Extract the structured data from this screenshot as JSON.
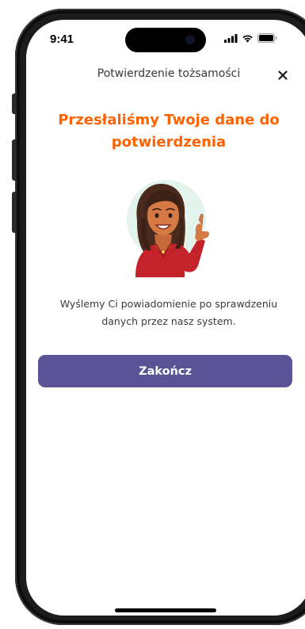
{
  "status_bar": {
    "time": "9:41"
  },
  "header": {
    "title": "Potwierdzenie tożsamości"
  },
  "content": {
    "headline": "Przesłaliśmy Twoje dane do potwierdzenia",
    "message": "Wyślemy Ci powiadomienie po sprawdzeniu danych przez nasz system."
  },
  "actions": {
    "finish_label": "Zakończ"
  },
  "icons": {
    "close": "close-icon",
    "illustration": "woman-thumbs-up-illustration",
    "signal": "cellular-signal-icon",
    "wifi": "wifi-icon",
    "battery": "battery-icon"
  },
  "colors": {
    "accent_orange": "#ff6200",
    "button_purple": "#5a5396",
    "illustration_bg": "#e3f4ec",
    "sweater_red": "#c4232c"
  }
}
